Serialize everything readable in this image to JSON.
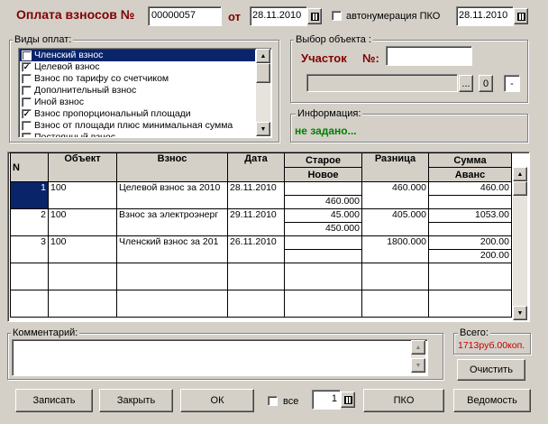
{
  "header": {
    "title": "Оплата взносов №",
    "doc_number": "00000057",
    "date_label": "от",
    "date": "28.11.2010",
    "autonum_label": "автонумерация ПКО",
    "autonum_checked": false,
    "pko_date": "28.11.2010"
  },
  "payment_types": {
    "label": "Виды оплат:",
    "items": [
      {
        "label": "Членский взнос",
        "checked": true,
        "mark": "✓",
        "selected": true
      },
      {
        "label": "Целевой взнос",
        "checked": true,
        "mark": "✓",
        "selected": false
      },
      {
        "label": "Взнос по тарифу со счетчиком",
        "checked": false,
        "mark": "",
        "selected": false
      },
      {
        "label": "Дополнительный взнос",
        "checked": false,
        "mark": "",
        "selected": false
      },
      {
        "label": "Иной взнос",
        "checked": false,
        "mark": "",
        "selected": false
      },
      {
        "label": "Взнос пропорциональный площади",
        "checked": true,
        "mark": "✓",
        "selected": false
      },
      {
        "label": "Взнос от площади плюс минимальная сумма",
        "checked": false,
        "mark": "",
        "selected": false
      },
      {
        "label": "Постоянный взнос",
        "checked": false,
        "mark": "",
        "selected": false
      }
    ]
  },
  "object_select": {
    "label": "Выбор объекта :",
    "plot_label": "Участок",
    "number_label": "№:",
    "plot_number": "",
    "combo_value": "",
    "browse_label": "...",
    "zero_label": "0",
    "dash_label": "-"
  },
  "info": {
    "label": "Информация:",
    "value": "не задано..."
  },
  "table": {
    "headers": {
      "n": "N",
      "object": "Объект",
      "fee": "Взнос",
      "date": "Дата",
      "old": "Старое",
      "new": "Новое",
      "diff": "Разница",
      "sum": "Сумма",
      "advance": "Аванс"
    },
    "rows": [
      {
        "n": "1",
        "object": "100",
        "fee": "Целевой взнос за 2010",
        "date": "28.11.2010",
        "old": "",
        "new": "460.000",
        "diff": "460.000",
        "sum": "460.00",
        "advance": ""
      },
      {
        "n": "2",
        "object": "100",
        "fee": "Взнос за электроэнерг",
        "date": "29.11.2010",
        "old": "45.000",
        "new": "450.000",
        "diff": "405.000",
        "sum": "1053.00",
        "advance": ""
      },
      {
        "n": "3",
        "object": "100",
        "fee": "Членский взнос за 201",
        "date": "26.11.2010",
        "old": "",
        "new": "",
        "diff": "1800.000",
        "sum": "200.00",
        "advance": "200.00"
      }
    ],
    "empty_rows": 2
  },
  "comment": {
    "label": "Комментарий:",
    "value": ""
  },
  "total": {
    "label": "Всего:",
    "value": "1713руб.00коп.",
    "clear_label": "Очистить"
  },
  "buttons": {
    "save": "Записать",
    "close": "Закрыть",
    "ok": "ОК",
    "all_label": "все",
    "all_checked": false,
    "count": "1",
    "pko": "ПКО",
    "statement": "Ведомость"
  },
  "colors": {
    "title": "#800000",
    "info_value": "#008000",
    "total_value": "#c00000",
    "selection": "#0a246a",
    "grid_row_highlight": "#0a246a"
  }
}
